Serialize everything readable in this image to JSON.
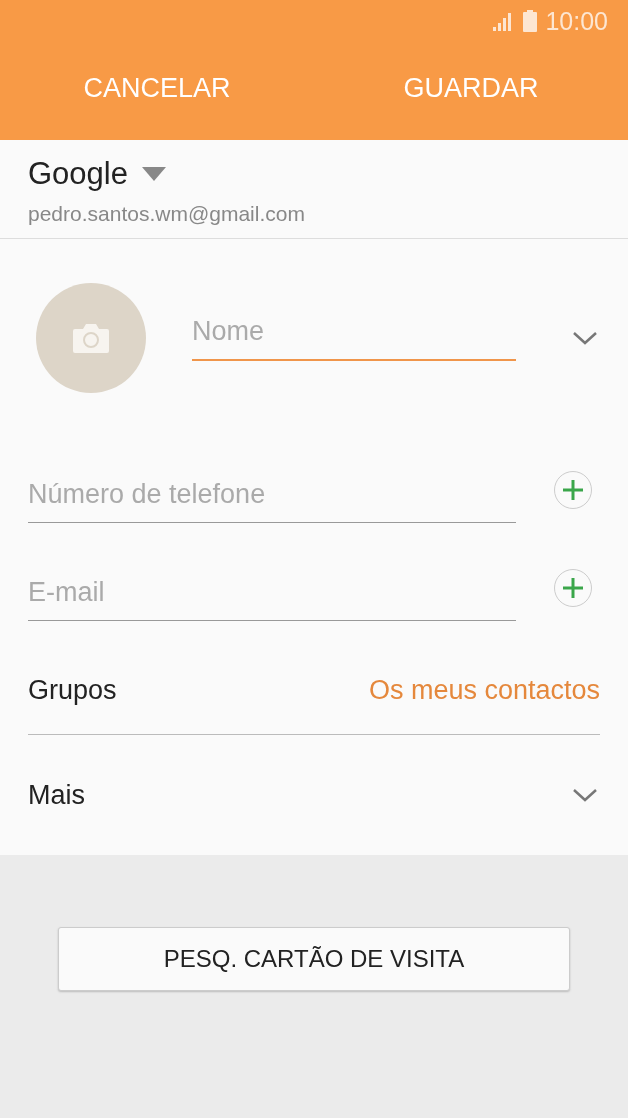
{
  "status_bar": {
    "time": "10:00"
  },
  "action_bar": {
    "buttons": [
      "CANCELAR",
      "GUARDAR"
    ]
  },
  "account": {
    "name": "Google",
    "email": "pedro.santos.wm@gmail.com"
  },
  "fields": [
    {
      "kind": "name",
      "placeholder": "Nome",
      "focused": true
    },
    {
      "kind": "add",
      "placeholder": "Número de telefone",
      "focused": false
    },
    {
      "kind": "add",
      "placeholder": "E-mail",
      "focused": false
    }
  ],
  "groups": {
    "label": "Grupos",
    "value": "Os meus contactos"
  },
  "more": {
    "label": "Mais"
  },
  "scan_button": "PESQ. CARTÃO DE VISITA"
}
